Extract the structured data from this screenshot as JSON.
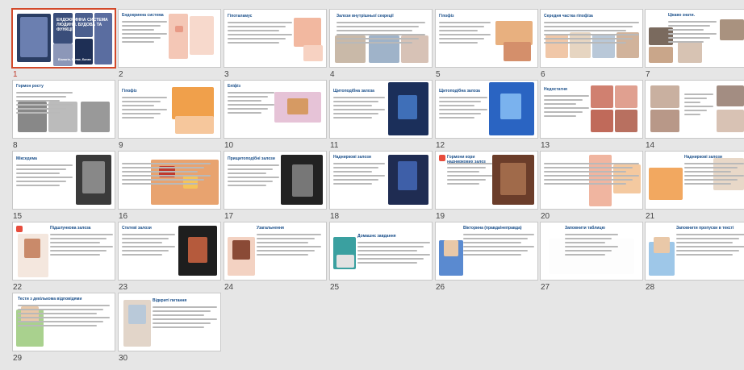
{
  "app": {
    "view": "Slide Sorter"
  },
  "colors": {
    "background": "#e6e6e6",
    "selection": "#d2492a",
    "thumb_bg": "#ffffff"
  },
  "selected_slide": 1,
  "slides": [
    {
      "number": "1",
      "title": "ЕНДОКРИННА СИСТЕМА ЛЮДИНИ. БУДОВА ТА ФУНКЦІЇ",
      "subtitle": "Біологія, 8 клас, Балан"
    },
    {
      "number": "2",
      "title": "Ендокринна система"
    },
    {
      "number": "3",
      "title": "Гіпоталамус"
    },
    {
      "number": "4",
      "title": "Залози внутрішньої секреції"
    },
    {
      "number": "5",
      "title": "Гіпофіз"
    },
    {
      "number": "6",
      "title": "Середня частка гіпофіза"
    },
    {
      "number": "7",
      "title": "Цікаво знати."
    },
    {
      "number": "8",
      "title": "Гормон росту"
    },
    {
      "number": "9",
      "title": "Гіпофіз"
    },
    {
      "number": "10",
      "title": "Епіфіз"
    },
    {
      "number": "11",
      "title": "Щитоподібна залоза"
    },
    {
      "number": "12",
      "title": "Щитоподібна залоза"
    },
    {
      "number": "13",
      "title": "Недостатня"
    },
    {
      "number": "14",
      "title": ""
    },
    {
      "number": "15",
      "title": "Мікседема"
    },
    {
      "number": "16",
      "title": ""
    },
    {
      "number": "17",
      "title": "Прищитоподібні залози"
    },
    {
      "number": "18",
      "title": "Надниркові залози"
    },
    {
      "number": "19",
      "title": "Гормони кори надниркових залоз"
    },
    {
      "number": "20",
      "title": ""
    },
    {
      "number": "21",
      "title": "Надниркові залози"
    },
    {
      "number": "22",
      "title": "Підшлункова залоза"
    },
    {
      "number": "23",
      "title": "Статеві залози"
    },
    {
      "number": "24",
      "title": "Узагальнення"
    },
    {
      "number": "25",
      "title": "Домашнє завдання"
    },
    {
      "number": "26",
      "title": "Вікторина (правда/неправда)"
    },
    {
      "number": "27",
      "title": "Заповнити таблицю"
    },
    {
      "number": "28",
      "title": "Заповнити пропуски в тексті"
    },
    {
      "number": "29",
      "title": "Тести з декількома відповідями"
    },
    {
      "number": "30",
      "title": "Відкриті питання"
    }
  ]
}
